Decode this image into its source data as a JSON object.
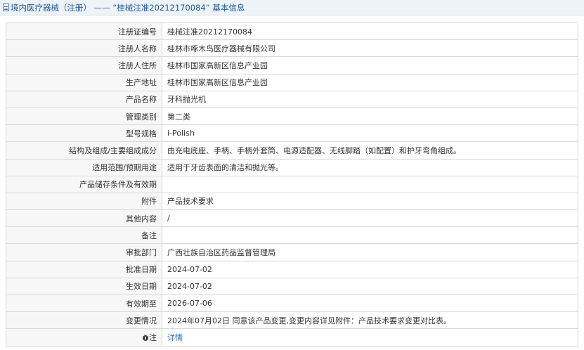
{
  "header": {
    "title": "境内医疗器械（注册） —— “桂械注准20212170084” 基本信息"
  },
  "rows": [
    {
      "label": "注册证编号",
      "value": "桂械注准20212170084"
    },
    {
      "label": "注册人名称",
      "value": "桂林市啄木鸟医疗器械有限公司"
    },
    {
      "label": "注册人住所",
      "value": "桂林市国家高新区信息产业园"
    },
    {
      "label": "生产地址",
      "value": "桂林市国家高新区信息产业园"
    },
    {
      "label": "产品名称",
      "value": "牙科抛光机"
    },
    {
      "label": "管理类别",
      "value": "第二类"
    },
    {
      "label": "型号规格",
      "value": "i-Polish"
    },
    {
      "label": "结构及组成/主要组成成分",
      "value": "由充电底座、手柄、手柄外套筒、电源适配器、无线脚踏（如配置）和护牙弯角组成。"
    },
    {
      "label": "适用范围/预期用途",
      "value": "适用于牙齿表面的清洁和抛光等。"
    },
    {
      "label": "产品储存条件及有效期",
      "value": ""
    },
    {
      "label": "附件",
      "value": "产品技术要求"
    },
    {
      "label": "其他内容",
      "value": "/"
    },
    {
      "label": "备注",
      "value": ""
    },
    {
      "label": "审批部门",
      "value": "广西壮族自治区药品监督管理局"
    },
    {
      "label": "批准日期",
      "value": "2024-07-02"
    },
    {
      "label": "生效日期",
      "value": "2024-07-02"
    },
    {
      "label": "有效期至",
      "value": "2026-07-06"
    },
    {
      "label": "变更情况",
      "value": "2024年07月02日 同意该产品变更,变更内容详见附件：产品技术要求变更对比表。"
    }
  ],
  "note_row": {
    "label": "注",
    "link_text": "详情"
  }
}
